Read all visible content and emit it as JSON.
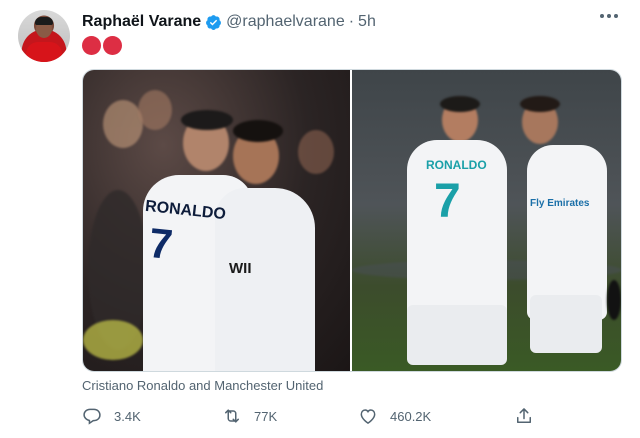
{
  "tweet": {
    "author_name": "Raphaël Varane",
    "handle": "@raphaelvarane",
    "separator": "·",
    "time": "5h",
    "caption": "Cristiano Ronaldo and Manchester United",
    "media_left_text": {
      "name": "RONALDO",
      "number": "7",
      "sponsor": "WII"
    },
    "media_right_text": {
      "name": "RONALDO",
      "number": "7",
      "sponsor": "Fly Emirates"
    }
  },
  "actions": {
    "reply_count": "3.4K",
    "retweet_count": "77K",
    "like_count": "460.2K"
  },
  "colors": {
    "verified": "#1d9bf0",
    "emoji_red": "#dd2e44",
    "text_secondary": "#536471",
    "jersey_teal": "#1aa0a8"
  },
  "icons": [
    "verified-badge-icon",
    "more-icon",
    "red-circle-emoji",
    "reply-icon",
    "retweet-icon",
    "like-icon",
    "share-icon"
  ]
}
